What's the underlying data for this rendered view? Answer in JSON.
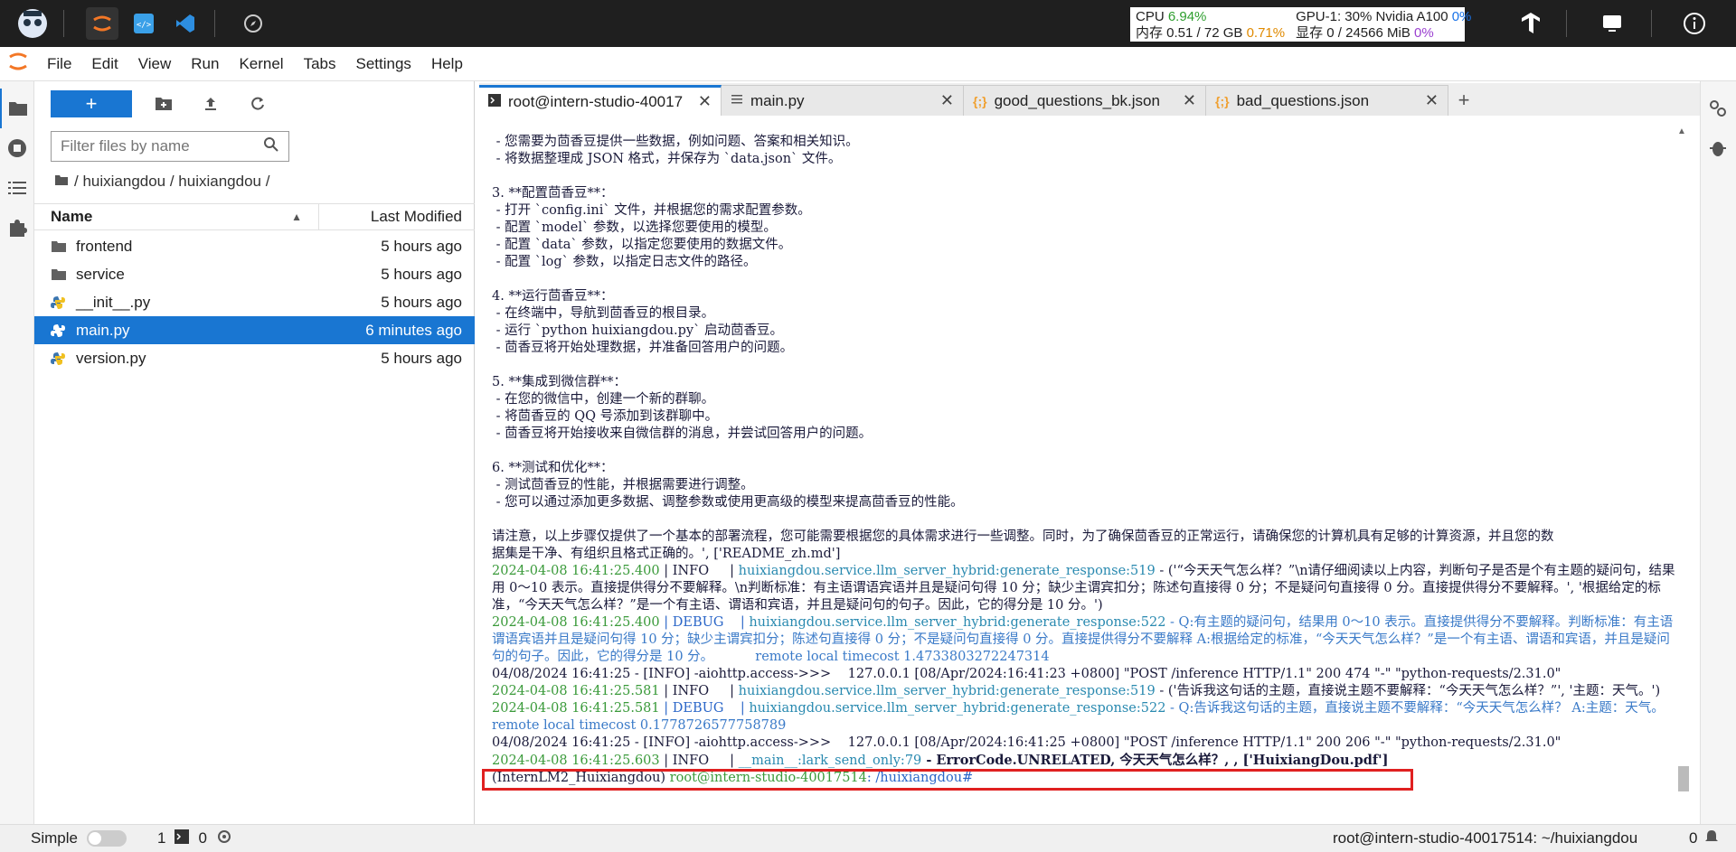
{
  "topbar": {
    "stats": {
      "cpu_label": "CPU",
      "cpu_value": "6.94%",
      "mem_label": "内存 0.51 / 72 GB",
      "mem_value": "0.71%",
      "gpu_label": "GPU-1: 30% Nvidia A100",
      "gpu_value": "0%",
      "vram_label": "显存 0 / 24566 MiB",
      "vram_value": "0%"
    }
  },
  "menu": [
    "File",
    "Edit",
    "View",
    "Run",
    "Kernel",
    "Tabs",
    "Settings",
    "Help"
  ],
  "filebrowser": {
    "new_label": "+",
    "filter_placeholder": "Filter files by name",
    "breadcrumb": "/ huixiangdou / huixiangdou /",
    "col_name": "Name",
    "col_modified": "Last Modified",
    "files": [
      {
        "name": "frontend",
        "modified": "5 hours ago",
        "icon": "folder-icon"
      },
      {
        "name": "service",
        "modified": "5 hours ago",
        "icon": "folder-icon"
      },
      {
        "name": "__init__.py",
        "modified": "5 hours ago",
        "icon": "python-icon"
      },
      {
        "name": "main.py",
        "modified": "6 minutes ago",
        "icon": "python-icon",
        "selected": true
      },
      {
        "name": "version.py",
        "modified": "5 hours ago",
        "icon": "python-icon"
      }
    ]
  },
  "tabs": [
    {
      "label": "root@intern-studio-40017",
      "icon": "terminal-icon",
      "active": true
    },
    {
      "label": "main.py",
      "icon": "text-icon"
    },
    {
      "label": "good_questions_bk.json",
      "icon": "json-icon"
    },
    {
      "label": "bad_questions.json",
      "icon": "json-icon"
    }
  ],
  "terminal": {
    "lines": [
      " - 您需要为茴香豆提供一些数据，例如问题、答案和相关知识。",
      " - 将数据整理成 JSON 格式，并保存为 `data.json` 文件。",
      "",
      "3. **配置茴香豆**：",
      " - 打开 `config.ini` 文件，并根据您的需求配置参数。",
      " - 配置 `model` 参数，以选择您要使用的模型。",
      " - 配置 `data` 参数，以指定您要使用的数据文件。",
      " - 配置 `log` 参数，以指定日志文件的路径。",
      "",
      "4. **运行茴香豆**：",
      " - 在终端中，导航到茴香豆的根目录。",
      " - 运行 `python huixiangdou.py` 启动茴香豆。",
      " - 茴香豆将开始处理数据，并准备回答用户的问题。",
      "",
      "5. **集成到微信群**：",
      " - 在您的微信中，创建一个新的群聊。",
      " - 将茴香豆的 QQ 号添加到该群聊中。",
      " - 茴香豆将开始接收来自微信群的消息，并尝试回答用户的问题。",
      "",
      "6. **测试和优化**：",
      " - 测试茴香豆的性能，并根据需要进行调整。",
      " - 您可以通过添加更多数据、调整参数或使用更高级的模型来提高茴香豆的性能。",
      "",
      "请注意，以上步骤仅提供了一个基本的部署流程，您可能需要根据您的具体需求进行一些调整。同时，为了确保茴香豆的正常运行，请确保您的计算机具有足够的计算资源，并且您的数",
      "据集是干净、有组织且格式正确的。', ['README_zh.md']"
    ],
    "log1_ts": "2024-04-08 16:41:25.400",
    "log1_level": " | INFO     | ",
    "log1_mod": "huixiangdou.service.llm_server_hybrid:generate_response:519",
    "log1_msg": " - ('“今天天气怎么样？”\\n请仔细阅读以上内容，判断句子是否是个有主题的疑问句，结果用 0～10 表示。直接提供得分不要解释。\\n判断标准：有主语谓语宾语并且是疑问句得 10 分；缺少主谓宾扣分；陈述句直接得 0 分；不是疑问句直接得 0 分。直接提供得分不要解释。', '根据给定的标准，“今天天气怎么样？”是一个有主语、谓语和宾语，并且是疑问句的句子。因此，它的得分是 10 分。')",
    "log2_ts": "2024-04-08 16:41:25.400",
    "log2_level": " | DEBUG    | ",
    "log2_mod": "huixiangdou.service.llm_server_hybrid:generate_response:522",
    "log2_msg": " - Q:有主题的疑问句，结果用 0～10 表示。直接提供得分不要解释。判断标准：有主语谓语宾语并且是疑问句得 10 分；缺少主谓宾扣分；陈述句直接得 0 分；不是疑问句直接得 0 分。直接提供得分不要解释 A:根据给定的标准，“今天天气怎么样？”是一个有主语、谓语和宾语，并且是疑问句的句子。因此，它的得分是 10 分。          remote local timecost 1.4733803272247314",
    "access1": "04/08/2024 16:41:25 - [INFO] -aiohttp.access->>>    127.0.0.1 [08/Apr/2024:16:41:23 +0800] \"POST /inference HTTP/1.1\" 200 474 \"-\" \"python-requests/2.31.0\"",
    "log3_ts": "2024-04-08 16:41:25.581",
    "log3_level": " | INFO     | ",
    "log3_mod": "huixiangdou.service.llm_server_hybrid:generate_response:519",
    "log3_msg": " - ('告诉我这句话的主题，直接说主题不要解释：“今天天气怎么样？”', '主题：天气。')",
    "log4_ts": "2024-04-08 16:41:25.581",
    "log4_level": " | DEBUG    | ",
    "log4_mod": "huixiangdou.service.llm_server_hybrid:generate_response:522",
    "log4_msg": " - Q:告诉我这句话的主题，直接说主题不要解释：“今天天气怎么样？ A:主题：天气。          remote local timecost 0.1778726577758789",
    "access2": "04/08/2024 16:41:25 - [INFO] -aiohttp.access->>>    127.0.0.1 [08/Apr/2024:16:41:25 +0800] \"POST /inference HTTP/1.1\" 200 206 \"-\" \"python-requests/2.31.0\"",
    "log5_ts": "2024-04-08 16:41:25.603",
    "log5_level": " | INFO     | ",
    "log5_mod": "__main__:lark_send_only:79",
    "log5_msg": " - ErrorCode.UNRELATED, 今天天气怎么样？, , ['HuixiangDou.pdf']",
    "prompt_env": "(InternLM2_Huixiangdou) ",
    "prompt_user": "root@intern-studio-40017514",
    "prompt_path": ": /huixiangdou#"
  },
  "statusbar": {
    "mode": "Simple",
    "kernels": "1",
    "terminals": "0",
    "right": "root@intern-studio-40017514: ~/huixiangdou",
    "right_count": "0"
  }
}
